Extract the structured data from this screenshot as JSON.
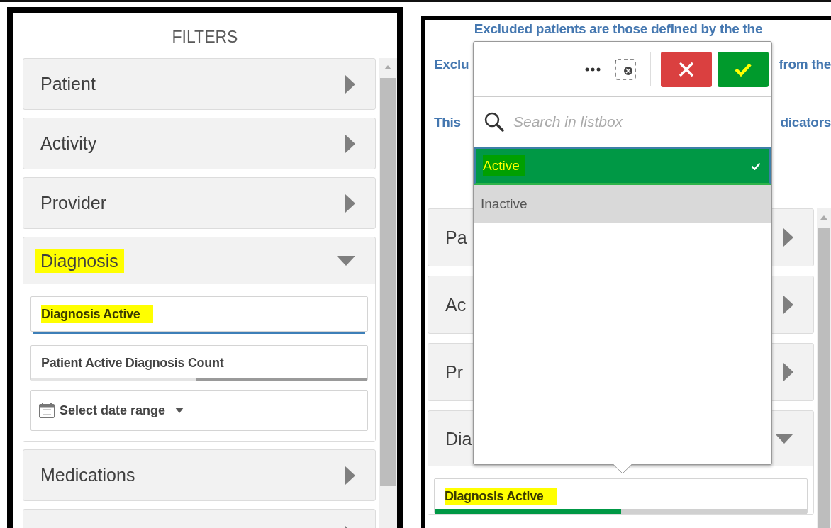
{
  "filters_panel": {
    "title": "FILTERS",
    "groups": [
      {
        "label": "Patient",
        "expanded": false,
        "highlighted": false
      },
      {
        "label": "Activity",
        "expanded": false,
        "highlighted": false
      },
      {
        "label": "Provider",
        "expanded": false,
        "highlighted": false
      },
      {
        "label": "Diagnosis",
        "expanded": true,
        "highlighted": true,
        "children": [
          {
            "kind": "listbox",
            "label": "Diagnosis Active",
            "highlighted": true,
            "open": true
          },
          {
            "kind": "listbox",
            "label": "Patient Active Diagnosis Count",
            "highlighted": false,
            "open": false,
            "level": 0.49
          },
          {
            "kind": "daterange",
            "label": "Select date range"
          }
        ]
      },
      {
        "label": "Medications",
        "expanded": false,
        "highlighted": false
      },
      {
        "expanded": false,
        "highlighted": false
      }
    ]
  },
  "dashboard_panel": {
    "note_lines": [
      {
        "parts": [
          "Excluded patients are those defined by the the"
        ]
      },
      {
        "parts": [
          "Exclu",
          "from the"
        ]
      },
      {
        "parts": [
          "This",
          "dicators"
        ]
      }
    ],
    "groups": [
      {
        "label": "Pa",
        "expanded": false,
        "highlighted": false
      },
      {
        "label": "Ac",
        "expanded": false,
        "highlighted": false
      },
      {
        "label": "Pr",
        "expanded": false,
        "highlighted": false
      },
      {
        "label": "Dia",
        "expanded": true,
        "highlighted": false,
        "children": [
          {
            "kind": "listbox",
            "label": "Diagnosis Active",
            "highlighted": true,
            "open": false,
            "level": 0.5,
            "color": "#009845"
          }
        ]
      }
    ],
    "listbox_popup": {
      "toolbar": [
        {
          "kind": "more"
        },
        {
          "kind": "clear"
        },
        {
          "kind": "cancel"
        },
        {
          "kind": "confirm",
          "highlighted": true
        }
      ],
      "search": {
        "placeholder": "Search in listbox"
      },
      "items": [
        {
          "label": "Active",
          "selected": true,
          "highlighted": true
        },
        {
          "label": "Inactive",
          "selected": false,
          "highlighted": false
        }
      ]
    }
  }
}
